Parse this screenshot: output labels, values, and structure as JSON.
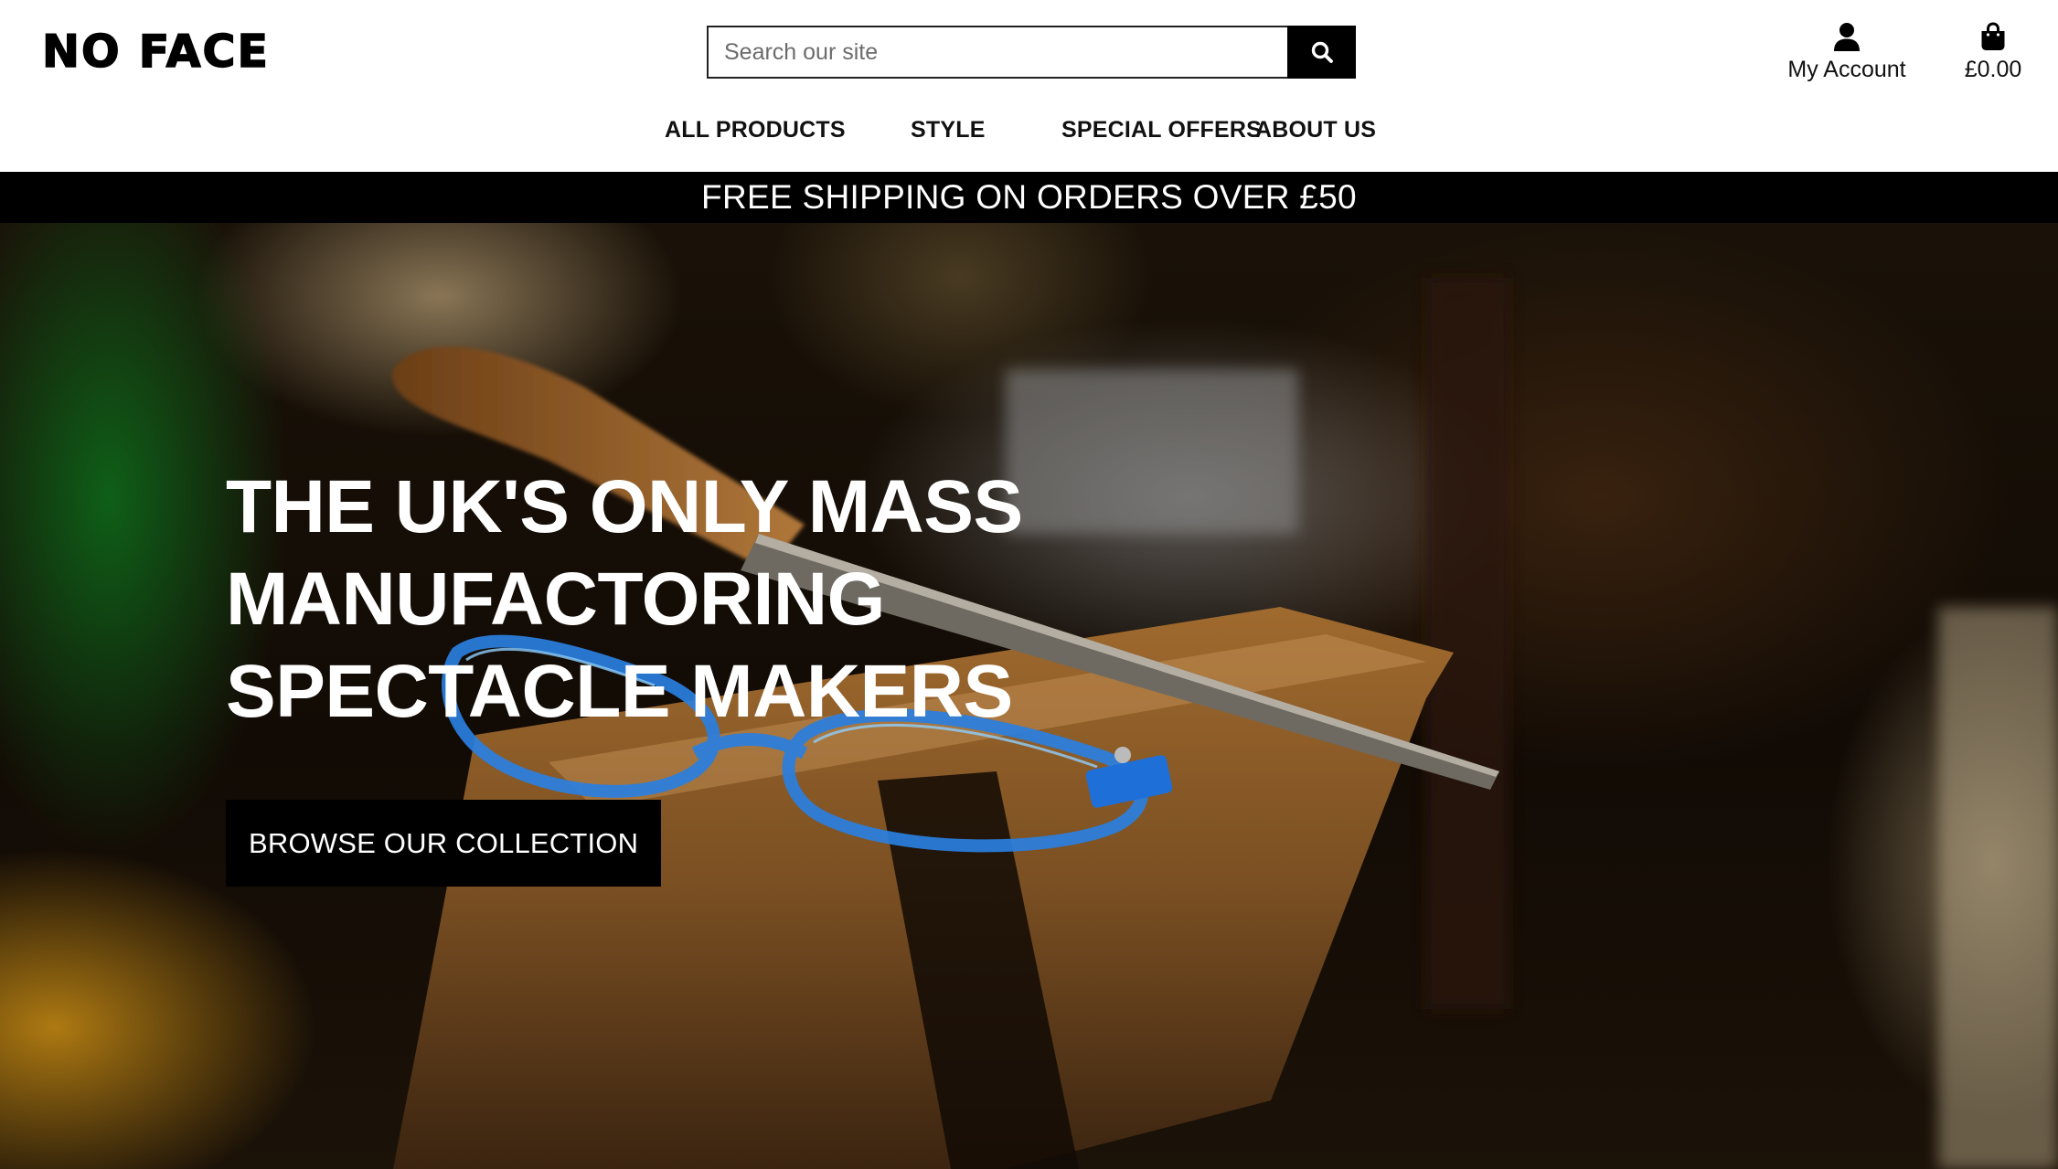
{
  "header": {
    "logo": "NO FACE",
    "search": {
      "placeholder": "Search our site",
      "button_icon": "search-icon"
    },
    "account": {
      "icon": "user-icon",
      "label": "My Account"
    },
    "cart": {
      "icon": "shopping-bag-icon",
      "label": "£0.00"
    }
  },
  "nav": {
    "items": [
      {
        "label": "ALL PRODUCTS"
      },
      {
        "label": "STYLE"
      },
      {
        "label": "SPECIAL OFFERS"
      },
      {
        "label": "ABOUT US"
      }
    ]
  },
  "banner": {
    "text": "FREE SHIPPING ON ORDERS OVER £50"
  },
  "hero": {
    "headline": "THE UK'S ONLY MASS MANUFACTORING SPECTACLE MAKERS",
    "cta_label": "BROWSE OUR COLLECTION",
    "image": "workbench-with-blue-spectacle-frames"
  },
  "colors": {
    "header_background": "#ffffff",
    "banner_background": "#000000",
    "button_background": "#000000",
    "text_light": "#ffffff",
    "text_dark": "#111111"
  }
}
